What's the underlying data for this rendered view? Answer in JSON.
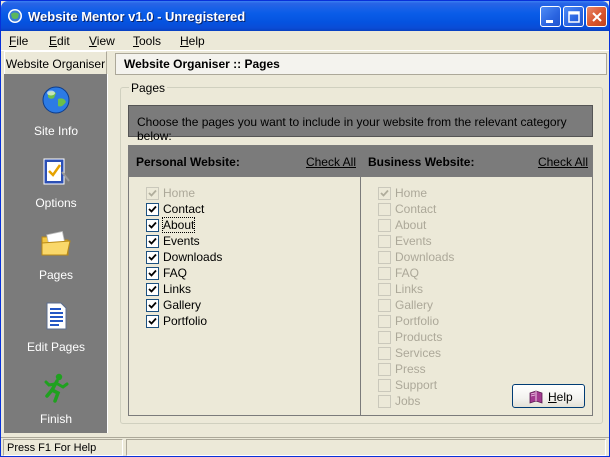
{
  "window": {
    "title": "Website Mentor v1.0 - Unregistered"
  },
  "menu": {
    "items": [
      {
        "first": "F",
        "rest": "ile"
      },
      {
        "first": "E",
        "rest": "dit"
      },
      {
        "first": "V",
        "rest": "iew"
      },
      {
        "first": "T",
        "rest": "ools"
      },
      {
        "first": "H",
        "rest": "elp"
      }
    ]
  },
  "nav": {
    "tab_label": "Website Organiser",
    "items": [
      {
        "label": "Site Info",
        "icon": "globe-icon"
      },
      {
        "label": "Options",
        "icon": "checklist-icon"
      },
      {
        "label": "Pages",
        "icon": "folder-icon"
      },
      {
        "label": "Edit Pages",
        "icon": "document-icon"
      },
      {
        "label": "Finish",
        "icon": "running-man-icon"
      }
    ]
  },
  "main": {
    "header": "Website Organiser :: Pages",
    "group_label": "Pages",
    "instructions": "Choose the pages you want to include in your website from the relevant category below:",
    "personal": {
      "title": "Personal Website:",
      "check_all": "Check All",
      "items": [
        {
          "label": "Home",
          "checked": true,
          "disabled": true
        },
        {
          "label": "Contact",
          "checked": true,
          "disabled": false
        },
        {
          "label": "About",
          "checked": true,
          "disabled": false,
          "focused": true
        },
        {
          "label": "Events",
          "checked": true,
          "disabled": false
        },
        {
          "label": "Downloads",
          "checked": true,
          "disabled": false
        },
        {
          "label": "FAQ",
          "checked": true,
          "disabled": false
        },
        {
          "label": "Links",
          "checked": true,
          "disabled": false
        },
        {
          "label": "Gallery",
          "checked": true,
          "disabled": false
        },
        {
          "label": "Portfolio",
          "checked": true,
          "disabled": false
        }
      ]
    },
    "business": {
      "title": "Business Website:",
      "check_all": "Check All",
      "items": [
        {
          "label": "Home",
          "checked": true,
          "disabled": true
        },
        {
          "label": "Contact",
          "checked": false,
          "disabled": true
        },
        {
          "label": "About",
          "checked": false,
          "disabled": true
        },
        {
          "label": "Events",
          "checked": false,
          "disabled": true
        },
        {
          "label": "Downloads",
          "checked": false,
          "disabled": true
        },
        {
          "label": "FAQ",
          "checked": false,
          "disabled": true
        },
        {
          "label": "Links",
          "checked": false,
          "disabled": true
        },
        {
          "label": "Gallery",
          "checked": false,
          "disabled": true
        },
        {
          "label": "Portfolio",
          "checked": false,
          "disabled": true
        },
        {
          "label": "Products",
          "checked": false,
          "disabled": true
        },
        {
          "label": "Services",
          "checked": false,
          "disabled": true
        },
        {
          "label": "Press",
          "checked": false,
          "disabled": true
        },
        {
          "label": "Support",
          "checked": false,
          "disabled": true
        },
        {
          "label": "Jobs",
          "checked": false,
          "disabled": true
        }
      ]
    },
    "help_button": {
      "first": "H",
      "rest": "elp",
      "icon": "book-icon"
    }
  },
  "status": {
    "text": "Press F1 For Help"
  },
  "colors": {
    "titlebar": "#0a5de8",
    "nav_background": "#7b7b7b",
    "window_face": "#ece9d8"
  }
}
